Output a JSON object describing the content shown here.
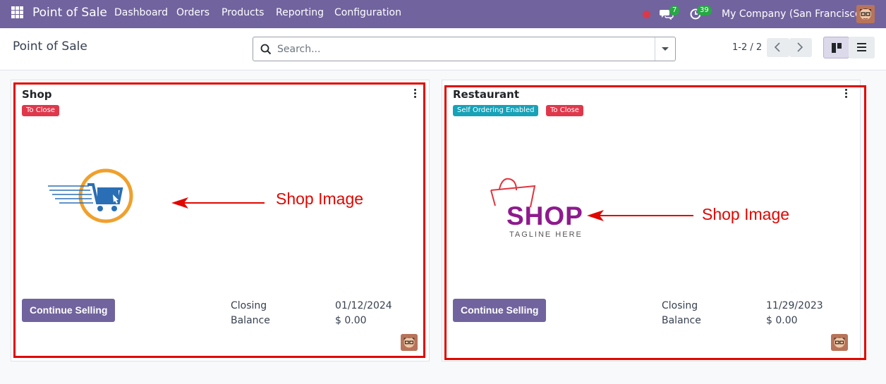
{
  "navbar": {
    "brand": "Point of Sale",
    "menu": [
      "Dashboard",
      "Orders",
      "Products",
      "Reporting",
      "Configuration"
    ],
    "messages_count": "7",
    "activities_count": "39",
    "company": "My Company (San Francisco)"
  },
  "control_panel": {
    "title": "Point of Sale",
    "search_placeholder": "Search...",
    "pager": "1-2 / 2"
  },
  "cards": [
    {
      "name": "Shop",
      "tags": [
        "To Close"
      ],
      "button": "Continue Selling",
      "closing_label": "Closing",
      "closing_value": "01/12/2024",
      "balance_label": "Balance",
      "balance_value": "$ 0.00",
      "annotation": "Shop Image"
    },
    {
      "name": "Restaurant",
      "tags": [
        "Self Ordering Enabled",
        "To Close"
      ],
      "logo_text": "SHOP",
      "logo_tagline": "TAGLINE HERE",
      "button": "Continue Selling",
      "closing_label": "Closing",
      "closing_value": "11/29/2023",
      "balance_label": "Balance",
      "balance_value": "$ 0.00",
      "annotation": "Shop Image"
    }
  ],
  "colors": {
    "navbar": "#71639e",
    "primary_button": "#71639e",
    "tag_to_close": "#e0384b",
    "tag_self_ordering": "#17a2b8",
    "annotation": "#e10600",
    "badge": "#28a745"
  }
}
